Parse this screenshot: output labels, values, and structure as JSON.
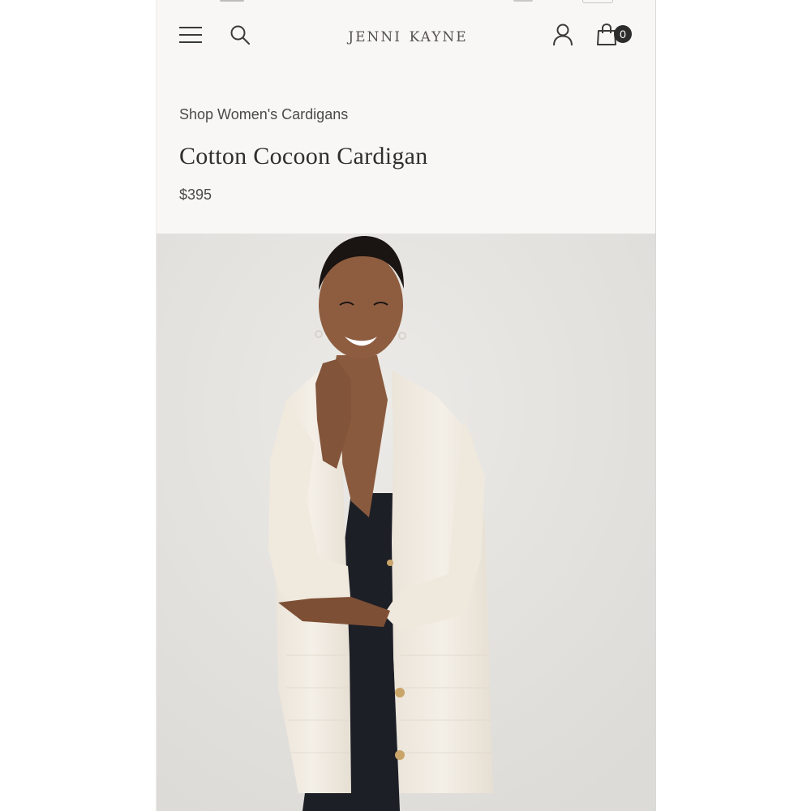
{
  "header": {
    "brand": "jenni kayne",
    "cart_count": "0",
    "icons": {
      "menu": "hamburger-menu-icon",
      "search": "search-icon",
      "account": "account-icon",
      "cart": "shopping-bag-icon"
    }
  },
  "product": {
    "breadcrumb": "Shop Women's Cardigans",
    "title": "Cotton Cocoon Cardigan",
    "price": "$395",
    "image_alt": "Woman wearing cream knit cocoon cardigan over black dress"
  },
  "colors": {
    "page_background": "#f8f7f5",
    "text_primary": "#2f2f2f",
    "badge_background": "#2c2c2c",
    "image_background": "#e4e3e0"
  }
}
